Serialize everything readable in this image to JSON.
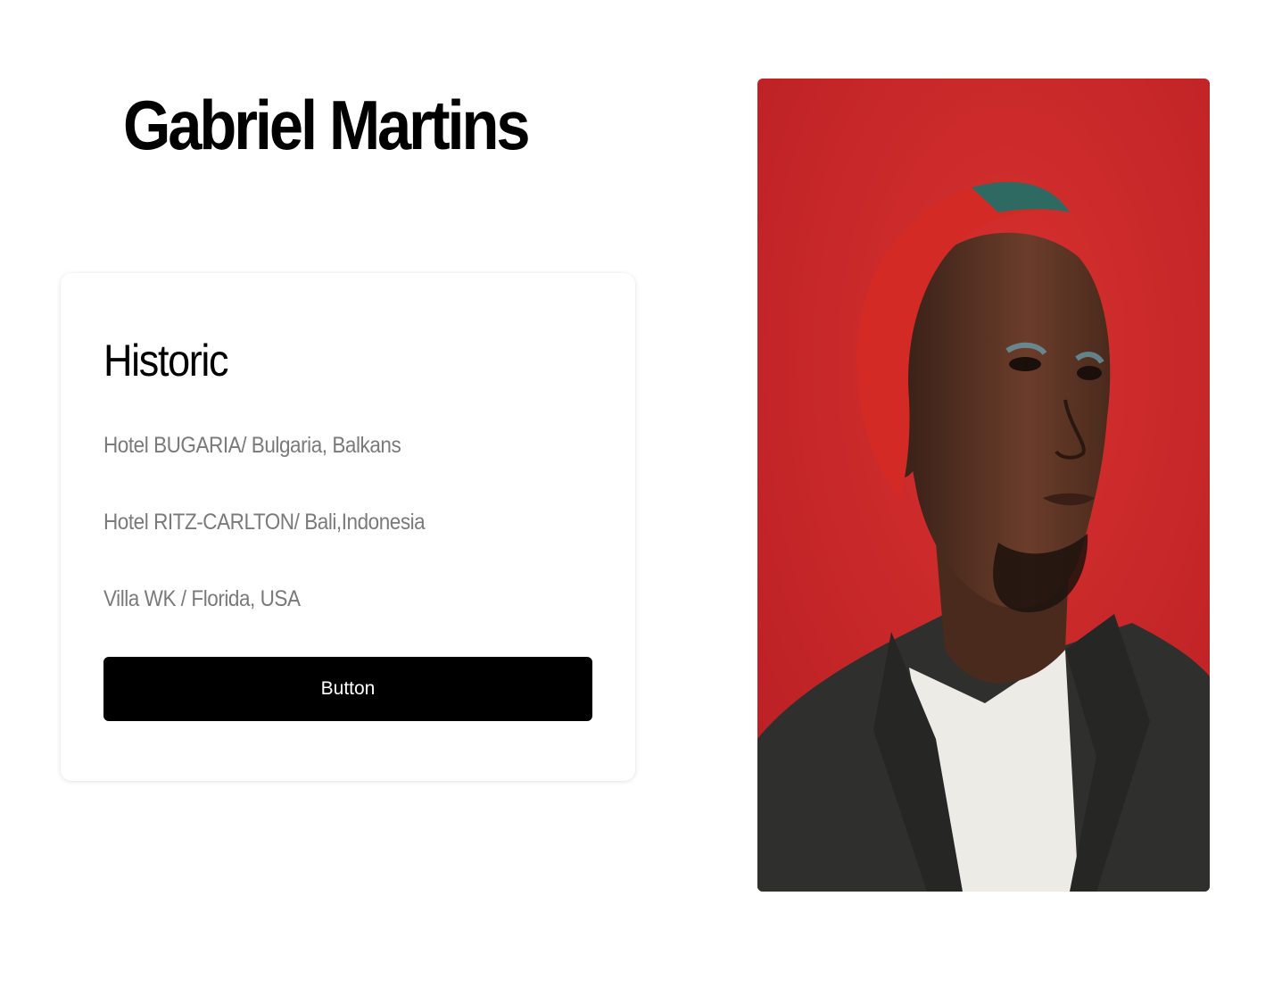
{
  "profile": {
    "name": "Gabriel Martins"
  },
  "card": {
    "heading": "Historic",
    "items": [
      "Hotel BUGARIA/ Bulgaria, Balkans",
      "Hotel RITZ-CARLTON/ Bali,Indonesia",
      "Villa WK / Florida, USA"
    ],
    "button_label": "Button"
  },
  "colors": {
    "page_background": "#ffffff",
    "title_text": "#000000",
    "item_text": "#7a7a7a",
    "button_background": "#000000",
    "button_text": "#ffffff",
    "photo_background": "#c8262a"
  }
}
